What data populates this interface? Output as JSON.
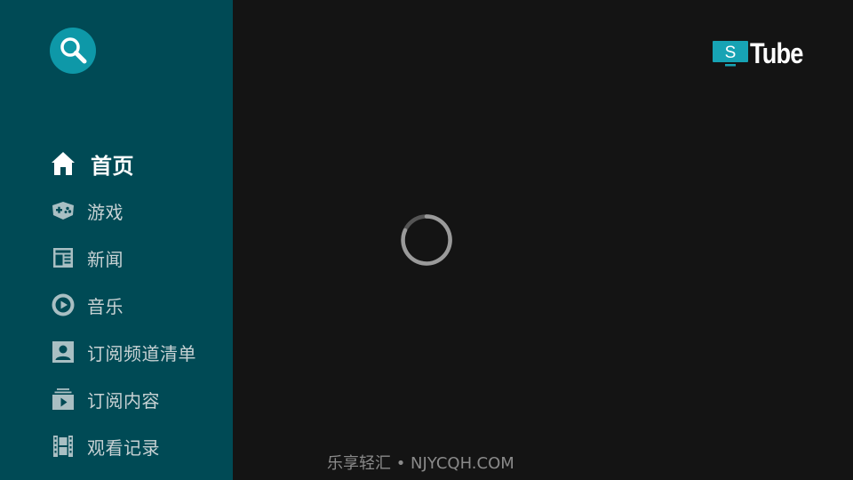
{
  "sidebar": {
    "search": {
      "icon": "search-icon"
    },
    "items": [
      {
        "label": "首页",
        "icon": "home-icon",
        "active": true
      },
      {
        "label": "游戏",
        "icon": "gamepad-icon",
        "active": false
      },
      {
        "label": "新闻",
        "icon": "newspaper-icon",
        "active": false
      },
      {
        "label": "音乐",
        "icon": "music-disc-icon",
        "active": false
      },
      {
        "label": "订阅频道清单",
        "icon": "account-box-icon",
        "active": false
      },
      {
        "label": "订阅内容",
        "icon": "subscriptions-icon",
        "active": false
      },
      {
        "label": "观看记录",
        "icon": "film-strip-icon",
        "active": false
      }
    ]
  },
  "header": {
    "logo_letter": "S",
    "logo_text": "Tube"
  },
  "main": {
    "loading": true
  },
  "watermark": "乐享轻汇 • NJYCQH.COM",
  "colors": {
    "sidebar_bg": "#004a55",
    "accent": "#0e98a8",
    "main_bg": "#141414"
  }
}
